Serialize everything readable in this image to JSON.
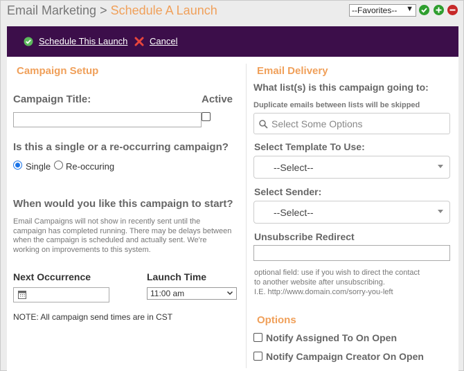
{
  "breadcrumb": {
    "parent": "Email Marketing",
    "separator": ">",
    "current": "Schedule A Launch"
  },
  "favorites": {
    "selected": "--Favorites--"
  },
  "actions": {
    "schedule_label": "Schedule This Launch",
    "cancel_label": "Cancel"
  },
  "campaign_setup": {
    "title": "Campaign Setup",
    "campaign_title_label": "Campaign Title:",
    "active_label": "Active",
    "campaign_title_value": "",
    "recurrence_question": "Is this a single or a re-occurring campaign?",
    "single_label": "Single",
    "reoccurring_label": "Re-occuring",
    "single_checked": true,
    "start_question": "When would you like this campaign to start?",
    "start_help": "Email Campaigns will not show in recently sent until the campaign has completed running. There may be delays between when the campaign is scheduled and actually sent. We're working on improvements to this system.",
    "next_occurrence_label": "Next Occurrence",
    "launch_time_label": "Launch Time",
    "launch_time_value": "11:00 am",
    "note": "NOTE: All campaign send times are in CST"
  },
  "email_delivery": {
    "title": "Email Delivery",
    "lists_question": "What list(s) is this campaign going to:",
    "duplicates_note": "Duplicate emails between lists will be skipped",
    "lists_placeholder": "Select Some Options",
    "template_label": "Select Template To Use:",
    "template_value": "--Select--",
    "sender_label": "Select Sender:",
    "sender_value": "--Select--",
    "unsubscribe_label": "Unsubscribe Redirect",
    "unsubscribe_value": "",
    "unsubscribe_help_1": "optional field: use if you wish to direct the contact",
    "unsubscribe_help_2": "to another website after unsubscribing.",
    "unsubscribe_help_3": "I.E. http://www.domain.com/sorry-you-left"
  },
  "options": {
    "title": "Options",
    "notify_assigned": "Notify Assigned To On Open",
    "notify_creator": "Notify Campaign Creator On Open"
  },
  "colors": {
    "accent": "#f0a05a",
    "action_bar": "#3c0e4a",
    "green": "#2e9e2e",
    "red": "#c62828"
  }
}
